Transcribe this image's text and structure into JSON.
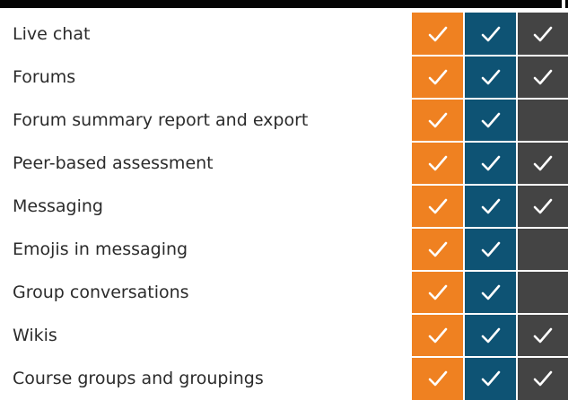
{
  "columns": [
    {
      "key": "orange",
      "color": "#ef8121"
    },
    {
      "key": "teal",
      "color": "#0e5374"
    },
    {
      "key": "dark",
      "color": "#444444"
    }
  ],
  "check_icon": "check-icon",
  "features": [
    {
      "label": "Live chat",
      "checks": [
        true,
        true,
        true
      ]
    },
    {
      "label": "Forums",
      "checks": [
        true,
        true,
        true
      ]
    },
    {
      "label": "Forum summary report and export",
      "checks": [
        true,
        true,
        false
      ]
    },
    {
      "label": "Peer-based assessment",
      "checks": [
        true,
        true,
        true
      ]
    },
    {
      "label": "Messaging",
      "checks": [
        true,
        true,
        true
      ]
    },
    {
      "label": "Emojis in messaging",
      "checks": [
        true,
        true,
        false
      ]
    },
    {
      "label": "Group conversations",
      "checks": [
        true,
        true,
        false
      ]
    },
    {
      "label": "Wikis",
      "checks": [
        true,
        true,
        true
      ]
    },
    {
      "label": "Course groups and groupings",
      "checks": [
        true,
        true,
        true
      ]
    }
  ]
}
